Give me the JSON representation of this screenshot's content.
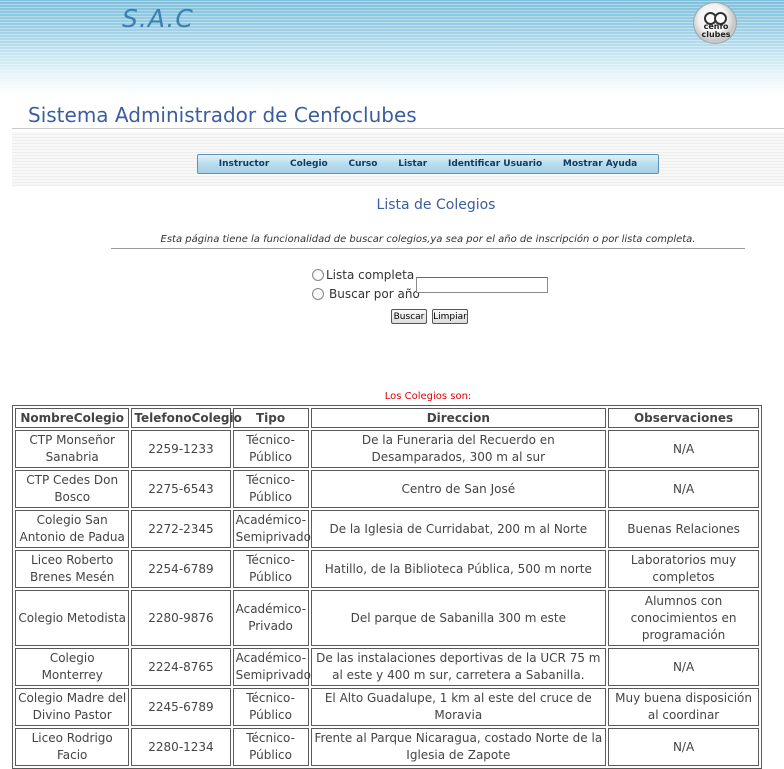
{
  "header": {
    "brand": "S.A.C",
    "logo_text": "cenfo clubes",
    "system_title": "Sistema Administrador de Cenfoclubes"
  },
  "nav": {
    "items": [
      "Instructor",
      "Colegio",
      "Curso",
      "Listar",
      "Identificar Usuario",
      "Mostrar Ayuda"
    ]
  },
  "page": {
    "heading": "Lista de Colegios",
    "description": "Esta página tiene la funcionalidad de buscar colegios,ya sea por el año de inscripción o por lista completa."
  },
  "search": {
    "option_full": "Lista completa",
    "option_year": "Buscar por año",
    "year_value": "",
    "search_button": "Buscar",
    "clear_button": "Limpiar"
  },
  "results": {
    "label": "Los Colegios son:",
    "columns": [
      "NombreColegio",
      "TelefonoColegio",
      "Tipo",
      "Direccion",
      "Observaciones"
    ],
    "rows": [
      [
        "CTP Monseñor Sanabria",
        "2259-1233",
        "Técnico-Público",
        "De la Funeraria del Recuerdo en Desamparados, 300 m al sur",
        "N/A"
      ],
      [
        "CTP Cedes Don Bosco",
        "2275-6543",
        "Técnico-Público",
        "Centro de San José",
        "N/A"
      ],
      [
        "Colegio San Antonio de Padua",
        "2272-2345",
        "Académico-Semiprivado",
        "De la Iglesia de Curridabat, 200 m al Norte",
        "Buenas Relaciones"
      ],
      [
        "Liceo Roberto Brenes Mesén",
        "2254-6789",
        "Técnico-Público",
        "Hatillo, de la Biblioteca Pública, 500 m norte",
        "Laboratorios muy completos"
      ],
      [
        "Colegio Metodista",
        "2280-9876",
        "Académico-Privado",
        "Del parque de Sabanilla 300 m este",
        "Alumnos con conocimientos en programación"
      ],
      [
        "Colegio Monterrey",
        "2224-8765",
        "Académico-Semiprivado",
        "De las instalaciones deportivas de la UCR 75 m al este y 400 m sur, carretera a Sabanilla.",
        "N/A"
      ],
      [
        "Colegio Madre del Divino Pastor",
        "2245-6789",
        "Técnico-Público",
        "El Alto Guadalupe, 1 km al este del cruce de Moravia",
        "Muy buena disposición al coordinar"
      ],
      [
        "Liceo Rodrigo Facio",
        "2280-1234",
        "Técnico-Público",
        "Frente al Parque Nicaragua, costado Norte de la Iglesia de Zapote",
        "N/A"
      ]
    ]
  }
}
